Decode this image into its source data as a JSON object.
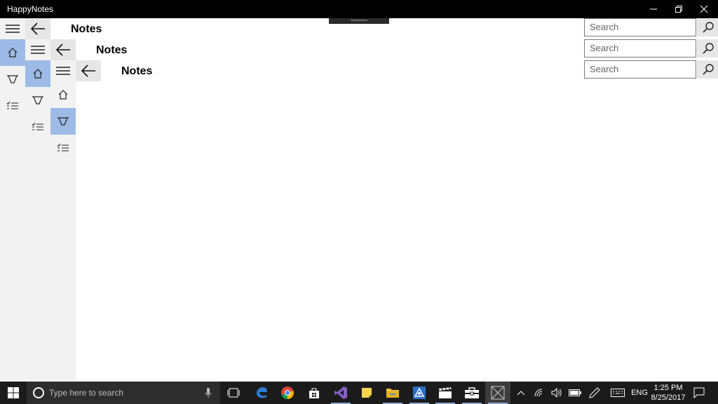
{
  "window": {
    "title": "HappyNotes"
  },
  "pages": [
    {
      "title": "Notes",
      "search_placeholder": "Search",
      "selected_nav": "home"
    },
    {
      "title": "Notes",
      "search_placeholder": "Search",
      "selected_nav": "home"
    },
    {
      "title": "Notes",
      "search_placeholder": "Search",
      "selected_nav": "filter"
    }
  ],
  "nav_icons": [
    "hamburger-icon",
    "back-arrow-icon",
    "home-icon",
    "funnel-icon",
    "checklist-icon",
    "search-icon"
  ],
  "taskbar": {
    "search_placeholder": "Type here to search",
    "language": "ENG",
    "time": "1:25 PM",
    "date": "8/25/2017"
  },
  "colors": {
    "titlebar": "#000000",
    "selected_nav": "#9dbbe6",
    "pane": "#f2f2f2",
    "taskbar": "#1b1b1b"
  }
}
